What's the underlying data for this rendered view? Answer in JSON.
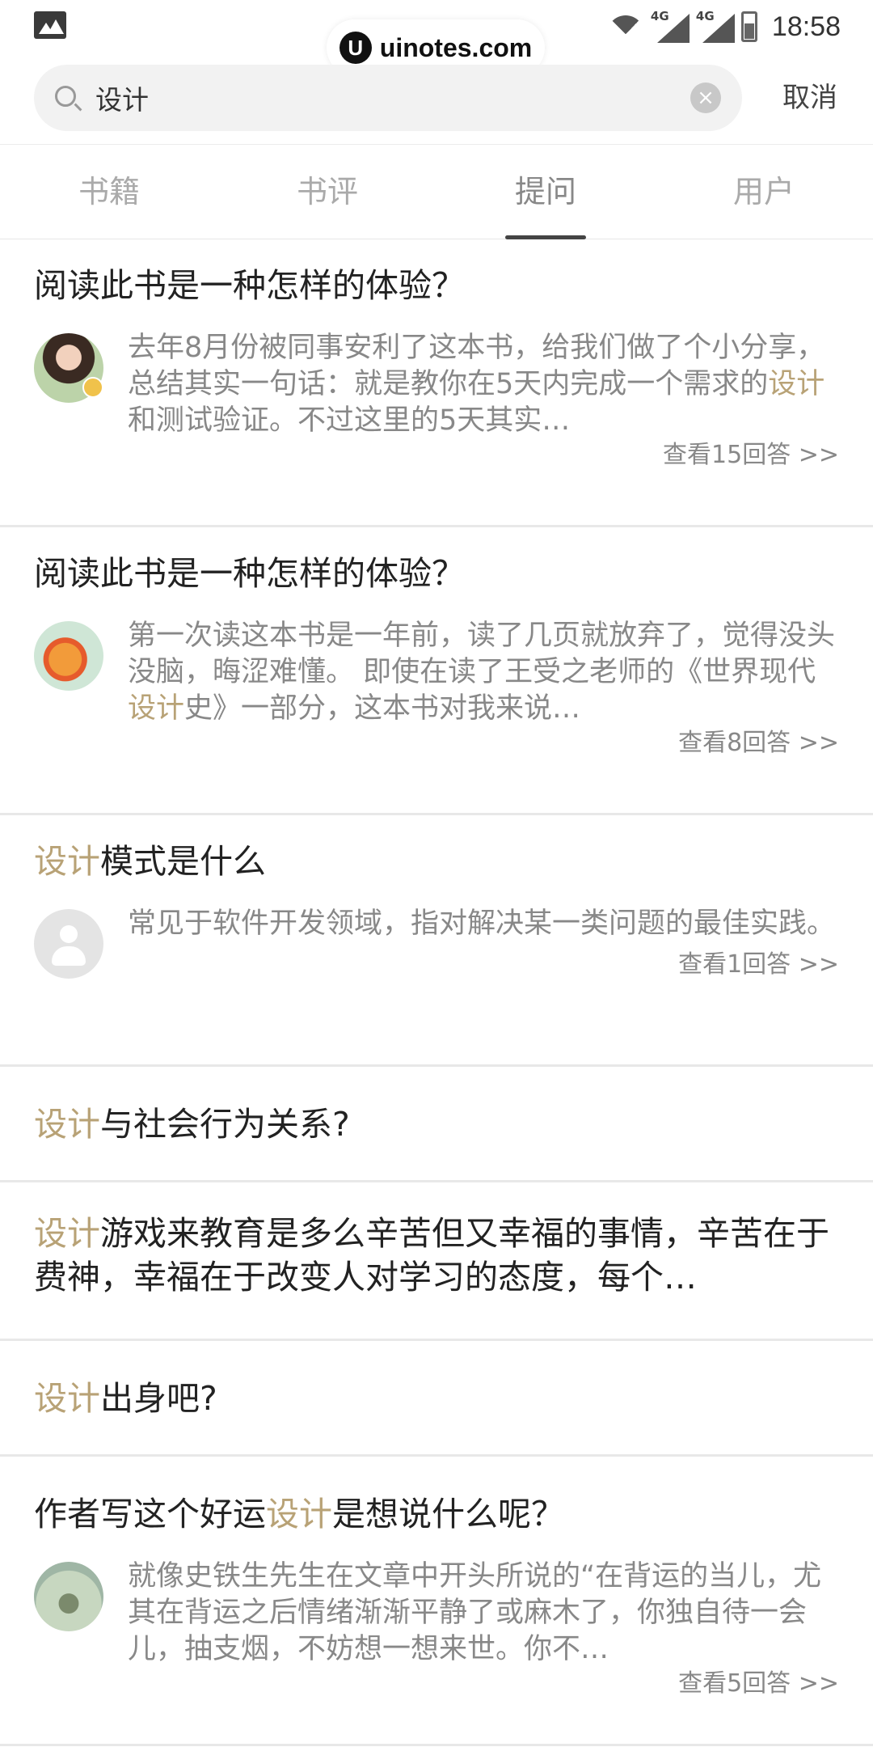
{
  "status_bar": {
    "time": "18:58",
    "network": [
      "4G",
      "4G"
    ],
    "watermark": "uinotes.com",
    "watermark_logo": "U"
  },
  "search": {
    "query": "设计",
    "clear_symbol": "×",
    "cancel_label": "取消"
  },
  "tabs": [
    {
      "label": "书籍",
      "active": false
    },
    {
      "label": "书评",
      "active": false
    },
    {
      "label": "提问",
      "active": true
    },
    {
      "label": "用户",
      "active": false
    }
  ],
  "highlight_color": "#b8a276",
  "items": [
    {
      "title_pre": "阅读此书是一种怎样的体验？",
      "title_hl": "",
      "title_post": "",
      "excerpt_pre": "去年8月份被同事安利了这本书，给我们做了个小分享，总结其实一句话：就是教你在5天内完成一个需求的",
      "excerpt_hl": "设计",
      "excerpt_post": "和测试验证。不过这里的5天其实…",
      "more": "查看15回答 >>"
    },
    {
      "title_pre": "阅读此书是一种怎样的体验？",
      "title_hl": "",
      "title_post": "",
      "excerpt_pre": "第一次读这本书是一年前，读了几页就放弃了，觉得没头没脑，晦涩难懂。 即使在读了王受之老师的《世界现代",
      "excerpt_hl": "设计",
      "excerpt_post": "史》一部分，这本书对我来说…",
      "more": "查看8回答 >>"
    },
    {
      "title_pre": "",
      "title_hl": "设计",
      "title_post": "模式是什么",
      "excerpt_pre": "常见于软件开发领域，指对解决某一类问题的最佳实践。",
      "excerpt_hl": "",
      "excerpt_post": "",
      "more": "查看1回答 >>"
    },
    {
      "title_pre": "",
      "title_hl": "设计",
      "title_post": "与社会行为关系?"
    },
    {
      "title_pre": "",
      "title_hl": "设计",
      "title_post": "游戏来教育是多么辛苦但又幸福的事情，辛苦在于费神，幸福在于改变人对学习的态度，每个…"
    },
    {
      "title_pre": "",
      "title_hl": "设计",
      "title_post": "出身吧?"
    },
    {
      "title_pre": "作者写这个好运",
      "title_hl": "设计",
      "title_post": "是想说什么呢？",
      "excerpt_pre": "就像史铁生先生在文章中开头所说的“在背运的当儿，尤其在背运之后情绪渐渐平静了或麻木了，你独自待一会儿，抽支烟，不妨想一想来世。你不…",
      "excerpt_hl": "",
      "excerpt_post": "",
      "more": "查看5回答 >>"
    }
  ]
}
